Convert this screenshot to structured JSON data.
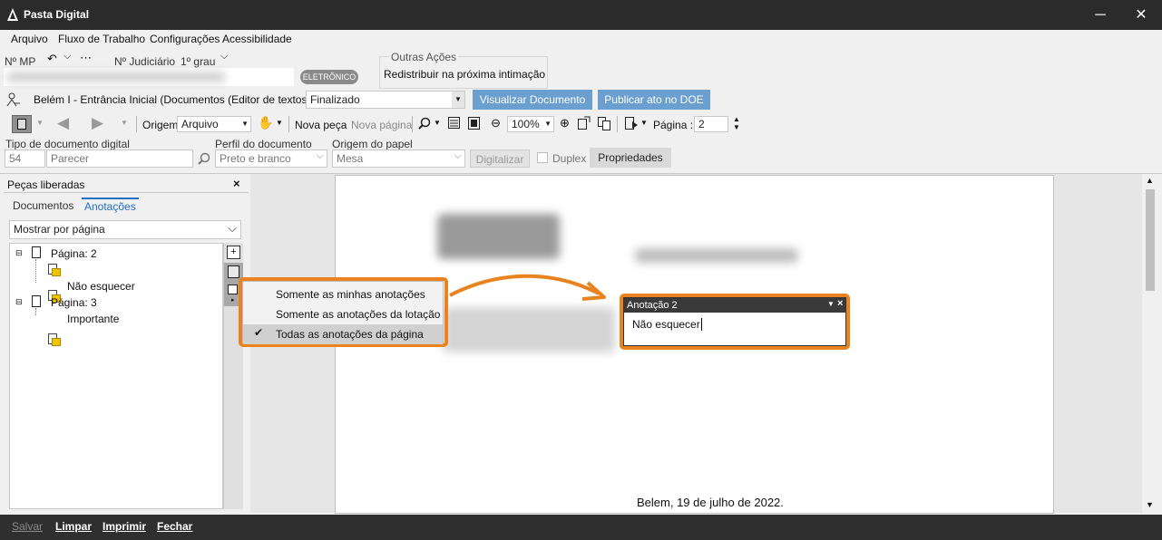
{
  "window": {
    "title": "Pasta Digital",
    "minimize": "─",
    "close": "✕"
  },
  "menu": [
    "Arquivo",
    "Fluxo de Trabalho",
    "Configurações",
    "Acessibilidade"
  ],
  "header": {
    "nmp_label": "Nº MP",
    "njud_label": "Nº Judiciário",
    "grau": "1º grau",
    "eletronico": "ELETRÔNICO",
    "outras_acoes_title": "Outras Ações",
    "outras_acoes_item": "Redistribuir na próxima intimação",
    "fila_text": "Belém I - Entrância Inicial (Documentos (Editor de textos)) - Fila",
    "fila_value": "Finalizado",
    "btn_visualizar": "Visualizar Documento",
    "btn_publicar": "Publicar ato no DOE"
  },
  "toolbar": {
    "origem_label": "Origem",
    "origem_value": "Arquivo",
    "nova_peca": "Nova peça",
    "nova_pagina": "Nova página",
    "zoom": "100%",
    "pagina_label": "Página :",
    "pagina_value": "2"
  },
  "docrow": {
    "tipo_label": "Tipo de documento digital",
    "tipo_code": "54",
    "tipo_value": "Parecer",
    "perfil_label": "Perfil do documento",
    "perfil_value": "Preto e branco",
    "origem_papel_label": "Origem do papel",
    "origem_papel_value": "Mesa",
    "digitalizar": "Digitalizar",
    "duplex": "Duplex",
    "propriedades": "Propriedades"
  },
  "sidebar": {
    "title": "Peças liberadas",
    "tabs": [
      "Documentos",
      "Anotações"
    ],
    "active_tab": "Anotações",
    "filter": "Mostrar por página",
    "tree": [
      {
        "label": "Página: 2",
        "notes": [
          "",
          "Não esquecer"
        ]
      },
      {
        "label": "Página: 3",
        "notes": [
          "Importante"
        ]
      }
    ]
  },
  "popup_menu": [
    "Somente as minhas anotações",
    "Somente as anotações da lotação",
    "Todas as anotações da página"
  ],
  "popup_checked_index": 2,
  "annotation": {
    "title": "Anotação 2",
    "text": "Não esquecer"
  },
  "document": {
    "date_line": "Belem, 19 de julho de 2022."
  },
  "footer": [
    "Salvar",
    "Limpar",
    "Imprimir",
    "Fechar"
  ],
  "colors": {
    "accent": "#6a9fd0",
    "highlight": "#e8831f",
    "titlebar": "#2b2b2b"
  }
}
